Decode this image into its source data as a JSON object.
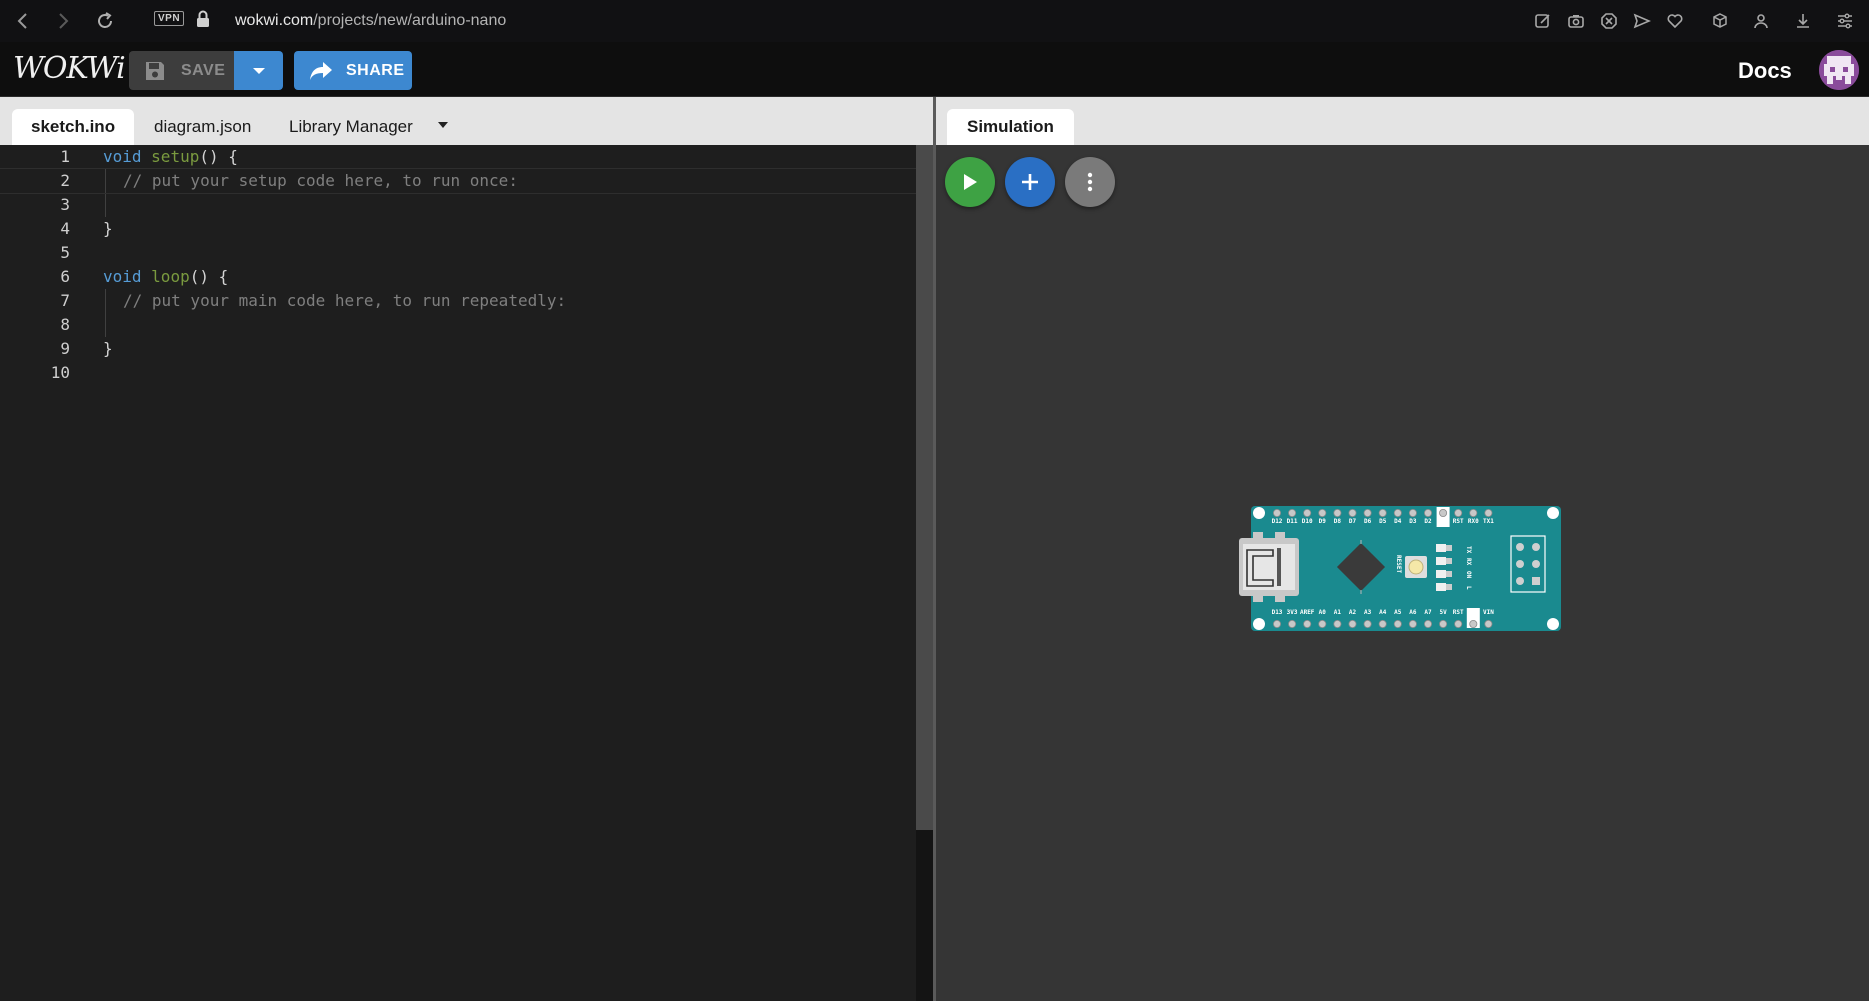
{
  "browser": {
    "vpn": "VPN",
    "url_host": "wokwi.com",
    "url_path": "/projects/new/arduino-nano"
  },
  "app": {
    "logo": "WOKWi",
    "save_label": "SAVE",
    "share_label": "SHARE",
    "docs_label": "Docs"
  },
  "editor": {
    "tabs": [
      "sketch.ino",
      "diagram.json",
      "Library Manager"
    ],
    "lines": [
      {
        "n": "1"
      },
      {
        "n": "2"
      },
      {
        "n": "3"
      },
      {
        "n": "4"
      },
      {
        "n": "5"
      },
      {
        "n": "6"
      },
      {
        "n": "7"
      },
      {
        "n": "8"
      },
      {
        "n": "9"
      },
      {
        "n": "10"
      }
    ],
    "code": {
      "kw_void": "void",
      "setup": "setup",
      "parens_brace": "() {",
      "setup_comment": "// put your setup code here, to run once:",
      "close_brace": "}",
      "loop": "loop",
      "loop_comment": "// put your main code here, to run repeatedly:"
    }
  },
  "simulation": {
    "tab_label": "Simulation",
    "board": {
      "top_pins": [
        "D12",
        "D11",
        "D10",
        "D9",
        "D8",
        "D7",
        "D6",
        "D5",
        "D4",
        "D3",
        "D2",
        "GND",
        "RST",
        "RX0",
        "TX1"
      ],
      "bottom_pins": [
        "D13",
        "3V3",
        "AREF",
        "A0",
        "A1",
        "A2",
        "A3",
        "A4",
        "A5",
        "A6",
        "A7",
        "5V",
        "RST",
        "GND",
        "VIN"
      ],
      "reset_label": "RESET",
      "led_labels": [
        "TX",
        "RX",
        "ON",
        "L"
      ]
    },
    "colors": {
      "play": "#3ea244",
      "add": "#2a6fc4",
      "more": "#7a7a7a",
      "board": "#1a8a8f"
    }
  }
}
